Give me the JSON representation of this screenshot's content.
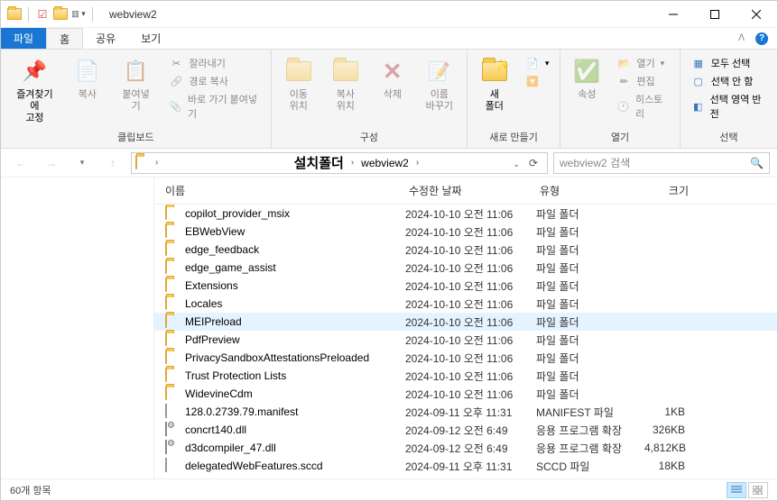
{
  "window": {
    "title": "webview2"
  },
  "tabs": {
    "file": "파일",
    "home": "홈",
    "share": "공유",
    "view": "보기"
  },
  "ribbon": {
    "clipboard": {
      "label": "클립보드",
      "pin": "즐겨찾기에\n고정",
      "copy": "복사",
      "paste": "붙여넣기",
      "cut": "잘라내기",
      "copypath": "경로 복사",
      "pasteshortcut": "바로 가기 붙여넣기"
    },
    "organize": {
      "label": "구성",
      "moveto": "이동\n위치",
      "copyto": "복사\n위치",
      "delete": "삭제",
      "rename": "이름\n바꾸기"
    },
    "new": {
      "label": "새로 만들기",
      "newfolder": "새\n폴더"
    },
    "open": {
      "label": "열기",
      "properties": "속성",
      "open": "열기",
      "edit": "편집",
      "history": "히스토리"
    },
    "select": {
      "label": "선택",
      "selectall": "모두 선택",
      "selectnone": "선택 안 함",
      "invert": "선택 영역 반전"
    }
  },
  "address": {
    "big_segment": "설치폴더",
    "segment": "webview2",
    "search_placeholder": "webview2 검색"
  },
  "columns": {
    "name": "이름",
    "date": "수정한 날짜",
    "type": "유형",
    "size": "크기"
  },
  "files": [
    {
      "icon": "folder",
      "name": "copilot_provider_msix",
      "date": "2024-10-10 오전 11:06",
      "type": "파일 폴더",
      "size": ""
    },
    {
      "icon": "folder",
      "name": "EBWebView",
      "date": "2024-10-10 오전 11:06",
      "type": "파일 폴더",
      "size": ""
    },
    {
      "icon": "folder",
      "name": "edge_feedback",
      "date": "2024-10-10 오전 11:06",
      "type": "파일 폴더",
      "size": ""
    },
    {
      "icon": "folder",
      "name": "edge_game_assist",
      "date": "2024-10-10 오전 11:06",
      "type": "파일 폴더",
      "size": ""
    },
    {
      "icon": "folder",
      "name": "Extensions",
      "date": "2024-10-10 오전 11:06",
      "type": "파일 폴더",
      "size": ""
    },
    {
      "icon": "folder",
      "name": "Locales",
      "date": "2024-10-10 오전 11:06",
      "type": "파일 폴더",
      "size": ""
    },
    {
      "icon": "folder",
      "name": "MEIPreload",
      "date": "2024-10-10 오전 11:06",
      "type": "파일 폴더",
      "size": "",
      "hover": true
    },
    {
      "icon": "folder",
      "name": "PdfPreview",
      "date": "2024-10-10 오전 11:06",
      "type": "파일 폴더",
      "size": ""
    },
    {
      "icon": "folder",
      "name": "PrivacySandboxAttestationsPreloaded",
      "date": "2024-10-10 오전 11:06",
      "type": "파일 폴더",
      "size": ""
    },
    {
      "icon": "folder",
      "name": "Trust Protection Lists",
      "date": "2024-10-10 오전 11:06",
      "type": "파일 폴더",
      "size": ""
    },
    {
      "icon": "folder",
      "name": "WidevineCdm",
      "date": "2024-10-10 오전 11:06",
      "type": "파일 폴더",
      "size": ""
    },
    {
      "icon": "file",
      "name": "128.0.2739.79.manifest",
      "date": "2024-09-11 오후 11:31",
      "type": "MANIFEST 파일",
      "size": "1KB"
    },
    {
      "icon": "dll",
      "name": "concrt140.dll",
      "date": "2024-09-12 오전 6:49",
      "type": "응용 프로그램 확장",
      "size": "326KB"
    },
    {
      "icon": "dll",
      "name": "d3dcompiler_47.dll",
      "date": "2024-09-12 오전 6:49",
      "type": "응용 프로그램 확장",
      "size": "4,812KB"
    },
    {
      "icon": "file",
      "name": "delegatedWebFeatures.sccd",
      "date": "2024-09-11 오후 11:31",
      "type": "SCCD 파일",
      "size": "18KB"
    }
  ],
  "status": {
    "count": "60개 항목"
  }
}
